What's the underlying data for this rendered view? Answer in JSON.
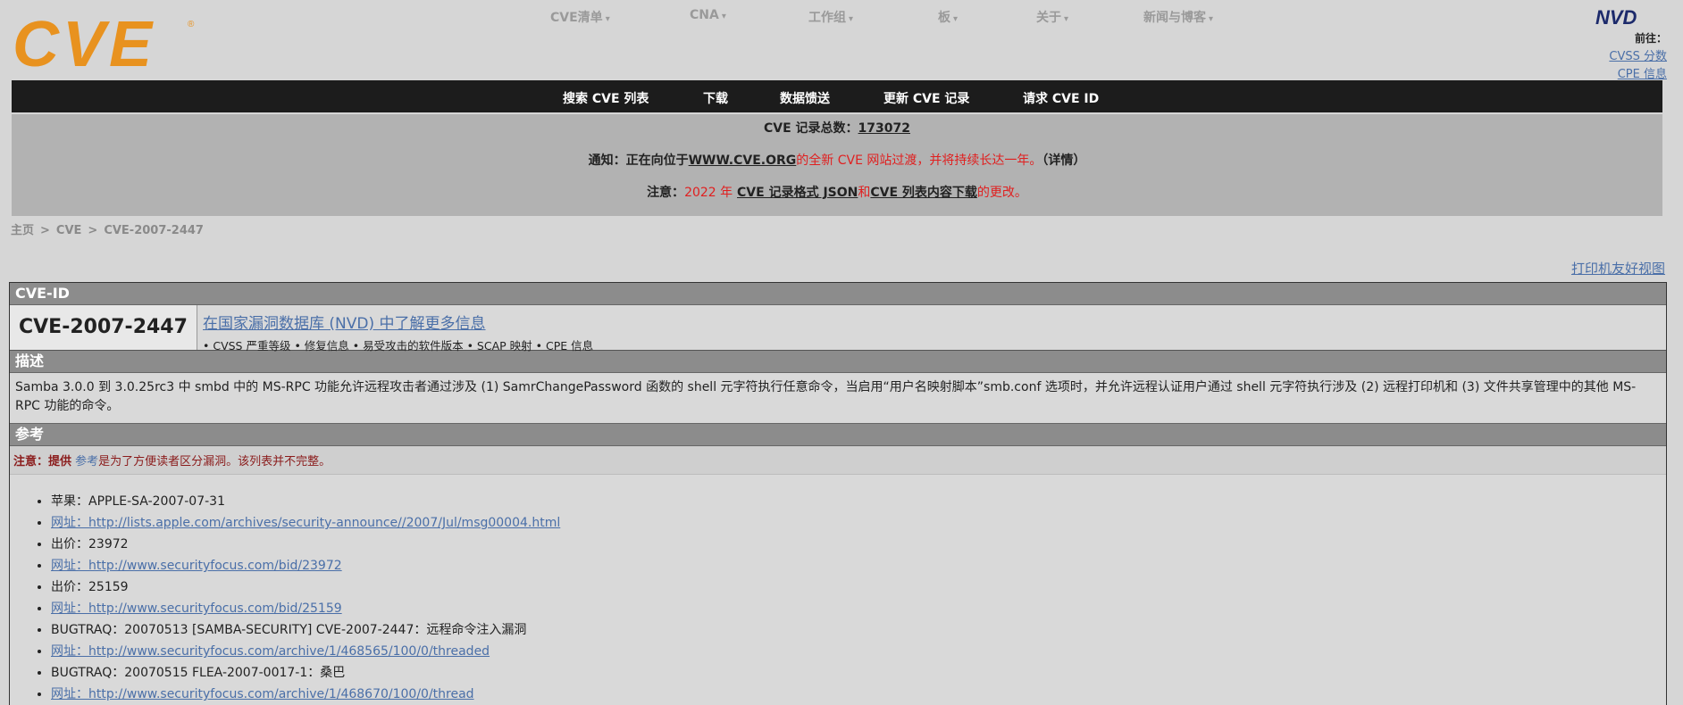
{
  "header": {
    "logo_text": "CVE",
    "nav": [
      {
        "label": "CVE清单"
      },
      {
        "label": "CNA"
      },
      {
        "label": "工作组"
      },
      {
        "label": "板"
      },
      {
        "label": "关于"
      },
      {
        "label": "新闻与博客"
      }
    ],
    "nvd": {
      "logo_text": "NVD",
      "goto_label": "前往：",
      "links": [
        "CVSS 分数",
        "CPE 信息"
      ]
    }
  },
  "main_nav": [
    "搜索 CVE 列表",
    "下载",
    "数据馈送",
    "更新 CVE 记录",
    "请求 CVE ID"
  ],
  "notice": {
    "total_label": "CVE 记录总数：",
    "total_value": "173072",
    "line2_prefix": "通知：正在向位于",
    "line2_link": "WWW.CVE.ORG",
    "line2_red": "的全新 CVE 网站过渡，并将持续长达一年。",
    "line2_details": "（详情）",
    "line3_prefix": "注意：",
    "line3_red1": "2022 年",
    "line3_link1": "CVE 记录格式 JSON",
    "line3_and": "和",
    "line3_link2": "CVE 列表内容下载",
    "line3_red2": "的更改。"
  },
  "breadcrumb": [
    "主页",
    "CVE",
    "CVE-2007-2447"
  ],
  "breadcrumb_sep": ">",
  "print_link": "打印机友好视图",
  "record": {
    "id_header": "CVE-ID",
    "id": "CVE-2007-2447",
    "nvd_more": "在国家漏洞数据库 (NVD) 中了解更多信息",
    "nvd_sub": "• CVSS 严重等级 • 修复信息 • 易受攻击的软件版本 • SCAP 映射 • CPE 信息",
    "desc_header": "描述",
    "description": "Samba 3.0.0 到 3.0.25rc3 中 smbd 中的 MS-RPC 功能允许远程攻击者通过涉及 (1) SamrChangePassword 函数的 shell 元字符执行任意命令，当启用“用户名映射脚本”smb.conf 选项时，并允许远程认证用户通过 shell 元字符执行涉及 (2) 远程打印机和 (3) 文件共享管理中的其他 MS-RPC 功能的命令。",
    "ref_header": "参考",
    "ref_note_bold": "注意：提供",
    "ref_note_link": "参考",
    "ref_note_rest": "是为了方便读者区分漏洞。该列表并不完整。",
    "references": [
      {
        "text": "苹果：APPLE-SA-2007-07-31",
        "link": false
      },
      {
        "text": "网址：http://lists.apple.com/archives/security-announce//2007/Jul/msg00004.html",
        "link": true
      },
      {
        "text": "出价：23972",
        "link": false
      },
      {
        "text": "网址：http://www.securityfocus.com/bid/23972",
        "link": true
      },
      {
        "text": "出价：25159",
        "link": false
      },
      {
        "text": "网址：http://www.securityfocus.com/bid/25159",
        "link": true
      },
      {
        "text": "BUGTRAQ：20070513 [SAMBA-SECURITY] CVE-2007-2447：远程命令注入漏洞",
        "link": false
      },
      {
        "text": "网址：http://www.securityfocus.com/archive/1/468565/100/0/threaded",
        "link": true
      },
      {
        "text": "BUGTRAQ：20070515 FLEA-2007-0017-1：桑巴",
        "link": false
      },
      {
        "text": "网址：http://www.securityfocus.com/archive/1/468670/100/0/thread",
        "link": true
      }
    ]
  },
  "colors": {
    "cve_logo_orange": "#e8921f",
    "nvd_navy": "#1c2a6b",
    "nav_black": "#1c1c1c",
    "notice_red": "#e02020",
    "link_blue": "#4a6fa8"
  }
}
